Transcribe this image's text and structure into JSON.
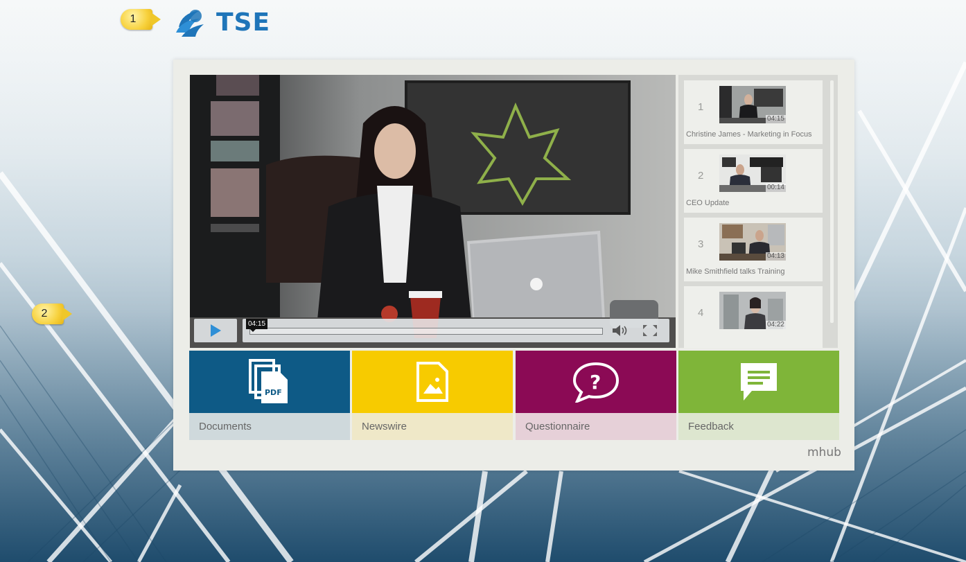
{
  "callouts": [
    {
      "number": "1"
    },
    {
      "number": "2"
    }
  ],
  "logo": {
    "text": "TSE",
    "color": "#1f75b9"
  },
  "player": {
    "current_time": "04:15",
    "progress": 0.0,
    "icons": [
      "play-icon",
      "volume-icon",
      "fullscreen-icon"
    ]
  },
  "playlist": [
    {
      "number": "1",
      "duration": "04:15",
      "title": "Christine James - Marketing in Focus"
    },
    {
      "number": "2",
      "duration": "00:14",
      "title": "CEO Update"
    },
    {
      "number": "3",
      "duration": "04:13",
      "title": "Mike Smithfield talks Training"
    },
    {
      "number": "4",
      "duration": "04:22",
      "title": ""
    }
  ],
  "tiles": [
    {
      "label": "Documents",
      "icon": "pdf-document-icon",
      "color": "#0e5a86",
      "label_bg": "#cfd9dc"
    },
    {
      "label": "Newswire",
      "icon": "image-document-icon",
      "color": "#f7cb00",
      "label_bg": "#efe8c8"
    },
    {
      "label": "Questionnaire",
      "icon": "question-bubble-icon",
      "color": "#8b0a55",
      "label_bg": "#e6d0d8"
    },
    {
      "label": "Feedback",
      "icon": "chat-icon",
      "color": "#7fb539",
      "label_bg": "#dde6cf"
    }
  ],
  "footer": {
    "brand": "mhub"
  }
}
